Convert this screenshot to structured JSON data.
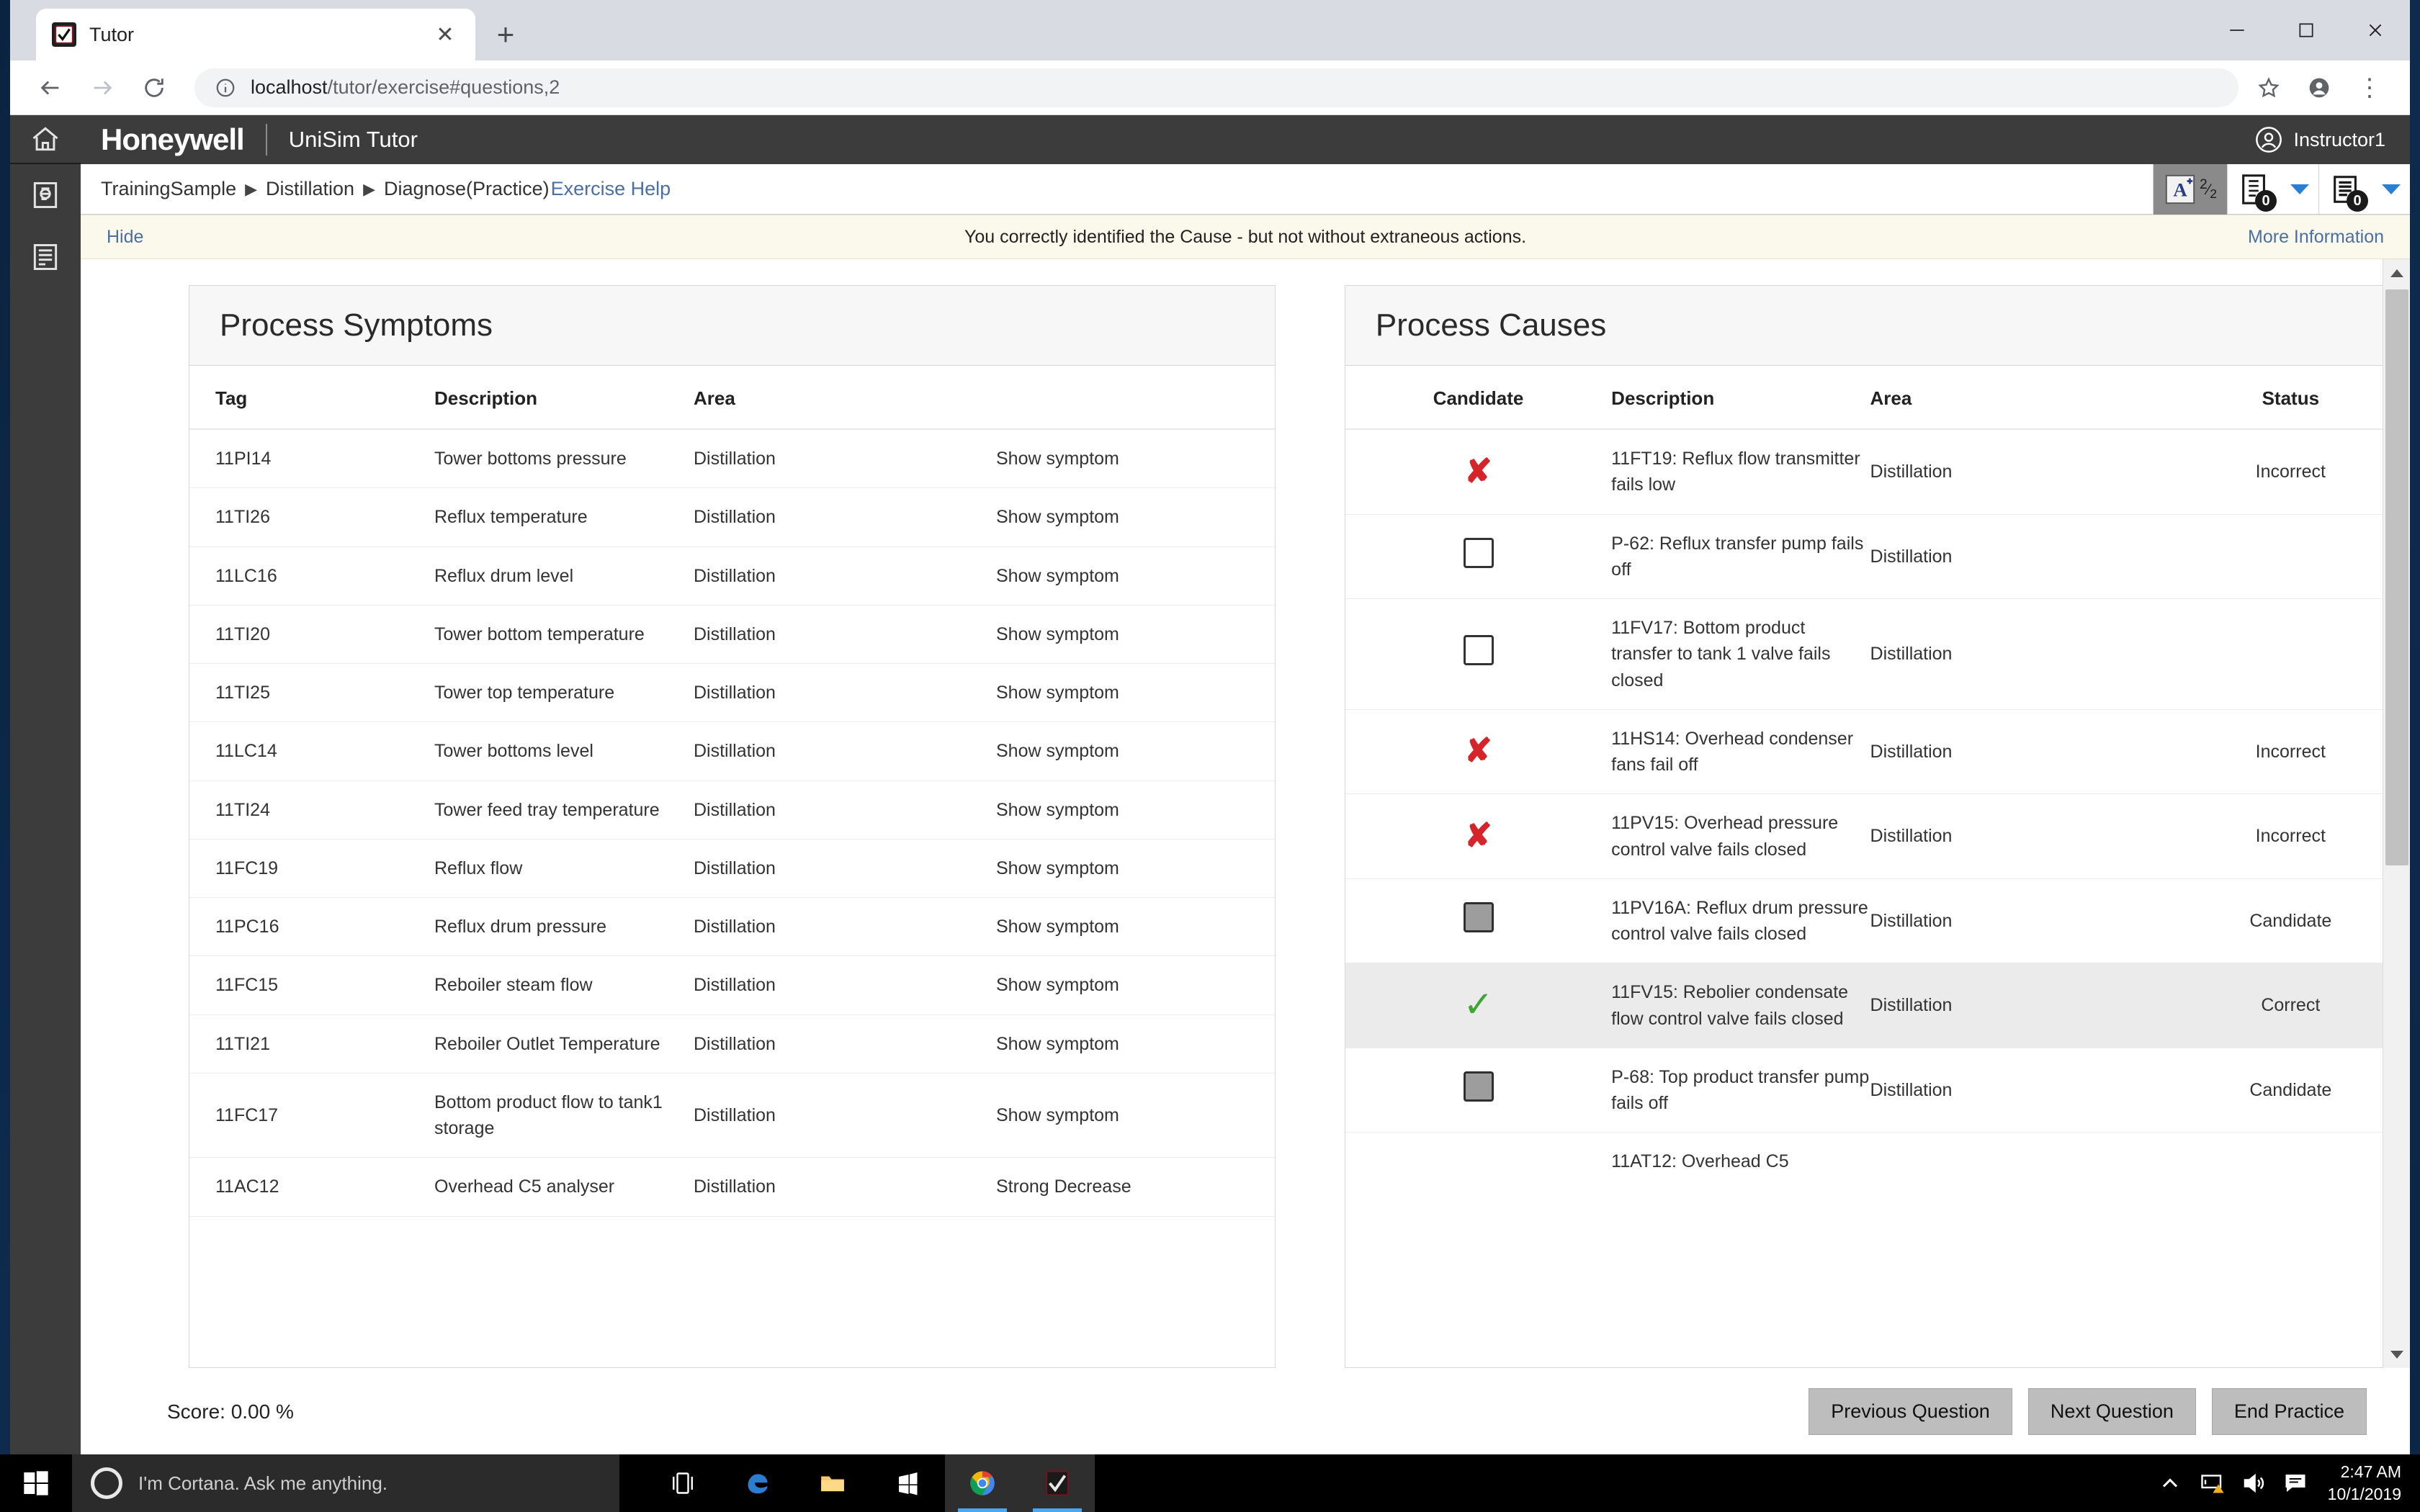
{
  "browser": {
    "tab": {
      "title": "Tutor",
      "favicon": "checkmark-icon",
      "close_label": "✕"
    },
    "newtab_label": "+",
    "url_text": "localhost",
    "url_path": "/tutor/exercise#questions,2",
    "window_controls": {
      "minimize": "–",
      "maximize": "□",
      "close": "✕"
    }
  },
  "rail": {
    "items": [
      {
        "name": "home",
        "icon": "home-icon"
      },
      {
        "name": "exercise",
        "icon": "exercise-document-icon"
      },
      {
        "name": "notes",
        "icon": "notes-list-icon"
      }
    ]
  },
  "header": {
    "brand": "Honeywell",
    "product": "UniSim Tutor",
    "user": "Instructor1"
  },
  "breadcrumb": {
    "items": [
      "TrainingSample",
      "Distillation",
      "Diagnose(Practice)"
    ],
    "separator": "▶",
    "help_link": "Exercise Help"
  },
  "toolbar": {
    "grade_icon": "grade-a-plus-icon",
    "grade_fraction_numerator": "2",
    "grade_fraction_denominator": "2",
    "questions_icon": "questions-document-icon",
    "questions_badge": "0",
    "notes_icon": "notes-document-icon",
    "notes_badge": "0",
    "caret": "▼"
  },
  "notice": {
    "hide_label": "Hide",
    "message": "You correctly identified the Cause - but not without extraneous actions.",
    "more_label": "More Information"
  },
  "symptoms": {
    "title": "Process Symptoms",
    "columns": [
      "Tag",
      "Description",
      "Area",
      ""
    ],
    "rows": [
      {
        "tag": "11PI14",
        "desc": "Tower bottoms pressure",
        "area": "Distillation",
        "action": "Show symptom"
      },
      {
        "tag": "11TI26",
        "desc": "Reflux temperature",
        "area": "Distillation",
        "action": "Show symptom"
      },
      {
        "tag": "11LC16",
        "desc": "Reflux drum level",
        "area": "Distillation",
        "action": "Show symptom"
      },
      {
        "tag": "11TI20",
        "desc": "Tower bottom temperature",
        "area": "Distillation",
        "action": "Show symptom"
      },
      {
        "tag": "11TI25",
        "desc": "Tower top temperature",
        "area": "Distillation",
        "action": "Show symptom"
      },
      {
        "tag": "11LC14",
        "desc": "Tower bottoms level",
        "area": "Distillation",
        "action": "Show symptom"
      },
      {
        "tag": "11TI24",
        "desc": "Tower feed tray temperature",
        "area": "Distillation",
        "action": "Show symptom"
      },
      {
        "tag": "11FC19",
        "desc": "Reflux flow",
        "area": "Distillation",
        "action": "Show symptom"
      },
      {
        "tag": "11PC16",
        "desc": "Reflux drum pressure",
        "area": "Distillation",
        "action": "Show symptom"
      },
      {
        "tag": "11FC15",
        "desc": "Reboiler steam flow",
        "area": "Distillation",
        "action": "Show symptom"
      },
      {
        "tag": "11TI21",
        "desc": "Reboiler Outlet Temperature",
        "area": "Distillation",
        "action": "Show symptom"
      },
      {
        "tag": "11FC17",
        "desc": "Bottom product flow to tank1 storage",
        "area": "Distillation",
        "action": "Show symptom"
      },
      {
        "tag": "11AC12",
        "desc": "Overhead C5 analyser",
        "area": "Distillation",
        "action": "Strong Decrease"
      }
    ]
  },
  "causes": {
    "title": "Process Causes",
    "columns": [
      "Candidate",
      "Description",
      "Area",
      "Status"
    ],
    "rows": [
      {
        "mark": "x",
        "desc": "11FT19: Reflux flow transmitter fails low",
        "area": "Distillation",
        "status": "Incorrect",
        "highlight": false
      },
      {
        "mark": "checkbox-empty",
        "desc": "P-62: Reflux transfer pump fails off",
        "area": "Distillation",
        "status": "",
        "highlight": false
      },
      {
        "mark": "checkbox-empty",
        "desc": "11FV17: Bottom product transfer to tank 1 valve fails closed",
        "area": "Distillation",
        "status": "",
        "highlight": false
      },
      {
        "mark": "x",
        "desc": "11HS14: Overhead condenser fans fail off",
        "area": "Distillation",
        "status": "Incorrect",
        "highlight": false
      },
      {
        "mark": "x",
        "desc": "11PV15: Overhead pressure control valve fails closed",
        "area": "Distillation",
        "status": "Incorrect",
        "highlight": false
      },
      {
        "mark": "checkbox-filled",
        "desc": "11PV16A: Reflux drum pressure control valve fails closed",
        "area": "Distillation",
        "status": "Candidate",
        "highlight": false
      },
      {
        "mark": "check",
        "desc": "11FV15: Rebolier condensate flow control valve fails closed",
        "area": "Distillation",
        "status": "Correct",
        "highlight": true
      },
      {
        "mark": "checkbox-filled",
        "desc": "P-68: Top product transfer pump fails off",
        "area": "Distillation",
        "status": "Candidate",
        "highlight": false
      },
      {
        "mark": "",
        "desc": "11AT12: Overhead C5",
        "area": "",
        "status": "",
        "highlight": false
      }
    ]
  },
  "footer": {
    "score": "Score: 0.00 %",
    "previous_label": "Previous Question",
    "next_label": "Next Question",
    "end_label": "End Practice"
  },
  "taskbar": {
    "start_icon": "windows-start-icon",
    "cortana_placeholder": "I'm Cortana. Ask me anything.",
    "apps": [
      "task-view-icon",
      "edge-icon",
      "file-explorer-icon",
      "store-icon",
      "chrome-icon",
      "tutor-icon"
    ],
    "tray": [
      "chevron-up-icon",
      "network-warning-icon",
      "volume-icon",
      "action-center-icon"
    ],
    "time": "2:47 AM",
    "date": "10/1/2019"
  },
  "colors": {
    "brand_bar": "#3c3c3c",
    "notice_bg": "#fbf8ec",
    "link": "#4a6fa5",
    "incorrect": "#d5252b",
    "correct": "#3fa535"
  }
}
